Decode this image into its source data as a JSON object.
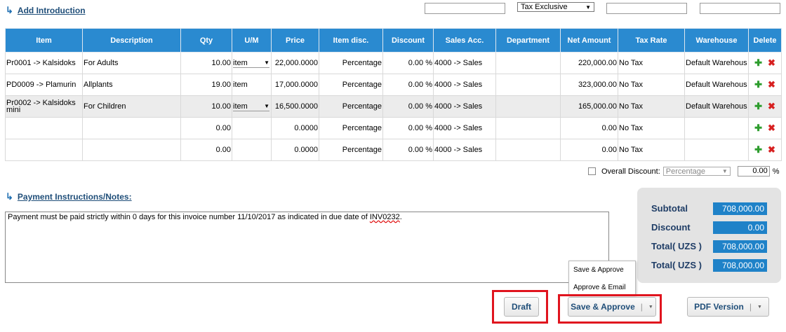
{
  "intro": {
    "label": "Add Introduction",
    "arrow": "↳"
  },
  "top_fields": {
    "tax_mode": "Tax Exclusive"
  },
  "table": {
    "headers": [
      "Item",
      "Description",
      "Qty",
      "U/M",
      "Price",
      "Item disc.",
      "Discount",
      "Sales Acc.",
      "Department",
      "Net Amount",
      "Tax Rate",
      "Warehouse",
      "Delete"
    ],
    "rows": [
      {
        "item": "Pr0001 -> Kalsidoks",
        "desc": "For Adults",
        "qty": "10.00",
        "um": "item",
        "price": "22,000.0000",
        "item_disc": "Percentage",
        "discount": "0.00 %",
        "sales_acc": "4000 -> Sales",
        "dept": "",
        "net": "220,000.00",
        "tax": "No Tax",
        "warehouse": "Default Warehouse"
      },
      {
        "item": "PD0009 -> Plamurin",
        "desc": "Allplants",
        "qty": "19.00",
        "um": "item",
        "price": "17,000.0000",
        "item_disc": "Percentage",
        "discount": "0.00 %",
        "sales_acc": "4000 -> Sales",
        "dept": "",
        "net": "323,000.00",
        "tax": "No Tax",
        "warehouse": "Default Warehouse"
      },
      {
        "item": "Pr0002 -> Kalsidoks mini",
        "desc": "For Children",
        "qty": "10.00",
        "um": "item",
        "price": "16,500.0000",
        "item_disc": "Percentage",
        "discount": "0.00 %",
        "sales_acc": "4000 -> Sales",
        "dept": "",
        "net": "165,000.00",
        "tax": "No Tax",
        "warehouse": "Default Warehouse"
      },
      {
        "item": "",
        "desc": "",
        "qty": "0.00",
        "um": "",
        "price": "0.0000",
        "item_disc": "Percentage",
        "discount": "0.00 %",
        "sales_acc": "4000 -> Sales",
        "dept": "",
        "net": "0.00",
        "tax": "No Tax",
        "warehouse": ""
      },
      {
        "item": "",
        "desc": "",
        "qty": "0.00",
        "um": "",
        "price": "0.0000",
        "item_disc": "Percentage",
        "discount": "0.00 %",
        "sales_acc": "4000 -> Sales",
        "dept": "",
        "net": "0.00",
        "tax": "No Tax",
        "warehouse": ""
      }
    ]
  },
  "overall_discount": {
    "label": "Overall Discount:",
    "type": "Percentage",
    "value": "0.00",
    "unit": "%"
  },
  "payment": {
    "label": "Payment Instructions/Notes:",
    "text_before": "Payment must be paid strictly within 0 days for this invoice number 11/10/2017 as indicated in due date of ",
    "text_underlined": "INV0232",
    "text_after": "."
  },
  "totals": [
    {
      "label": "Subtotal",
      "value": "708,000.00"
    },
    {
      "label": "Discount",
      "value": "0.00"
    },
    {
      "label": "Total( UZS )",
      "value": "708,000.00"
    },
    {
      "label": "Total( UZS )",
      "value": "708,000.00"
    }
  ],
  "save_menu": [
    "Save & Approve",
    "Approve & Email"
  ],
  "buttons": {
    "draft": "Draft",
    "save_approve": "Save & Approve",
    "pdf": "PDF Version"
  },
  "colors": {
    "header_blue": "#2a8ad0",
    "highlight_red": "#e0141e",
    "total_blue": "#1f82c8"
  }
}
